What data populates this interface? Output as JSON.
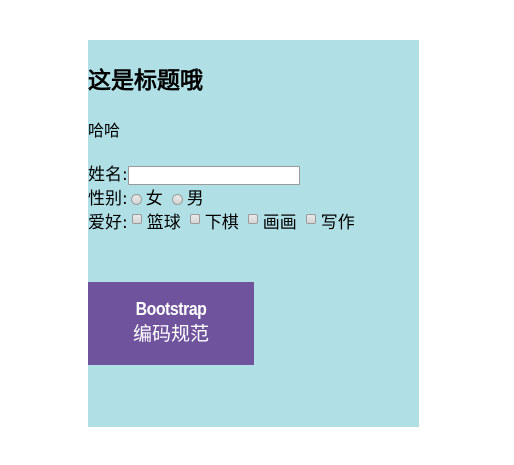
{
  "page": {
    "title": "这是标题哦",
    "paragraph": "哈哈"
  },
  "form": {
    "name_label": "姓名:",
    "name_value": "",
    "gender_label": "性别:",
    "gender_options": [
      "女",
      "男"
    ],
    "hobby_label": "爱好:",
    "hobby_options": [
      "篮球",
      "下棋",
      "画画",
      "写作"
    ]
  },
  "banner": {
    "brand": "Bootstrap",
    "subtitle": "编码规范"
  },
  "colors": {
    "panel_background": "#b0e0e6",
    "banner_background": "#6f539c",
    "banner_text": "#ffffff"
  }
}
